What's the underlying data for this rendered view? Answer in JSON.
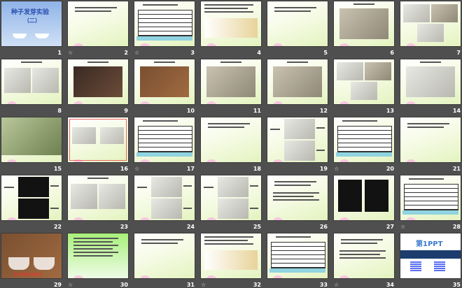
{
  "slides": [
    {
      "n": "1",
      "kind": "title",
      "star": false,
      "title": "种子发芽实验",
      "subtitle": "（二）"
    },
    {
      "n": "2",
      "kind": "text",
      "star": true
    },
    {
      "n": "3",
      "kind": "table",
      "star": true
    },
    {
      "n": "4",
      "kind": "textimg",
      "star": false
    },
    {
      "n": "5",
      "kind": "text",
      "star": false
    },
    {
      "n": "6",
      "kind": "photo",
      "star": false
    },
    {
      "n": "7",
      "kind": "photo3",
      "star": false
    },
    {
      "n": "8",
      "kind": "photo2",
      "star": false
    },
    {
      "n": "9",
      "kind": "photodark",
      "star": false
    },
    {
      "n": "10",
      "kind": "photowood",
      "star": false
    },
    {
      "n": "11",
      "kind": "photo",
      "star": false
    },
    {
      "n": "12",
      "kind": "photo",
      "star": false
    },
    {
      "n": "13",
      "kind": "photo3",
      "star": false
    },
    {
      "n": "14",
      "kind": "photowhite",
      "star": false
    },
    {
      "n": "15",
      "kind": "photofull",
      "star": false
    },
    {
      "n": "16",
      "kind": "form",
      "star": false
    },
    {
      "n": "17",
      "kind": "table",
      "star": true
    },
    {
      "n": "18",
      "kind": "text",
      "star": false
    },
    {
      "n": "19",
      "kind": "stack",
      "star": false
    },
    {
      "n": "20",
      "kind": "table",
      "star": true
    },
    {
      "n": "21",
      "kind": "text",
      "star": false
    },
    {
      "n": "22",
      "kind": "stackdark",
      "star": false
    },
    {
      "n": "23",
      "kind": "photo2",
      "star": false
    },
    {
      "n": "24",
      "kind": "stack",
      "star": false
    },
    {
      "n": "25",
      "kind": "stack",
      "star": false
    },
    {
      "n": "26",
      "kind": "text",
      "star": false
    },
    {
      "n": "27",
      "kind": "side2",
      "star": false
    },
    {
      "n": "28",
      "kind": "table",
      "star": true
    },
    {
      "n": "29",
      "kind": "photocap",
      "star": false,
      "caption": "种子发芽与空气的关系"
    },
    {
      "n": "30",
      "kind": "green",
      "star": true
    },
    {
      "n": "31",
      "kind": "text",
      "star": false
    },
    {
      "n": "32",
      "kind": "textimg",
      "star": true
    },
    {
      "n": "33",
      "kind": "table",
      "star": false
    },
    {
      "n": "34",
      "kind": "text",
      "star": true
    },
    {
      "n": "35",
      "kind": "logo",
      "star": false,
      "logo": "第1PPT"
    }
  ],
  "icons": {
    "animation": "star-icon"
  }
}
